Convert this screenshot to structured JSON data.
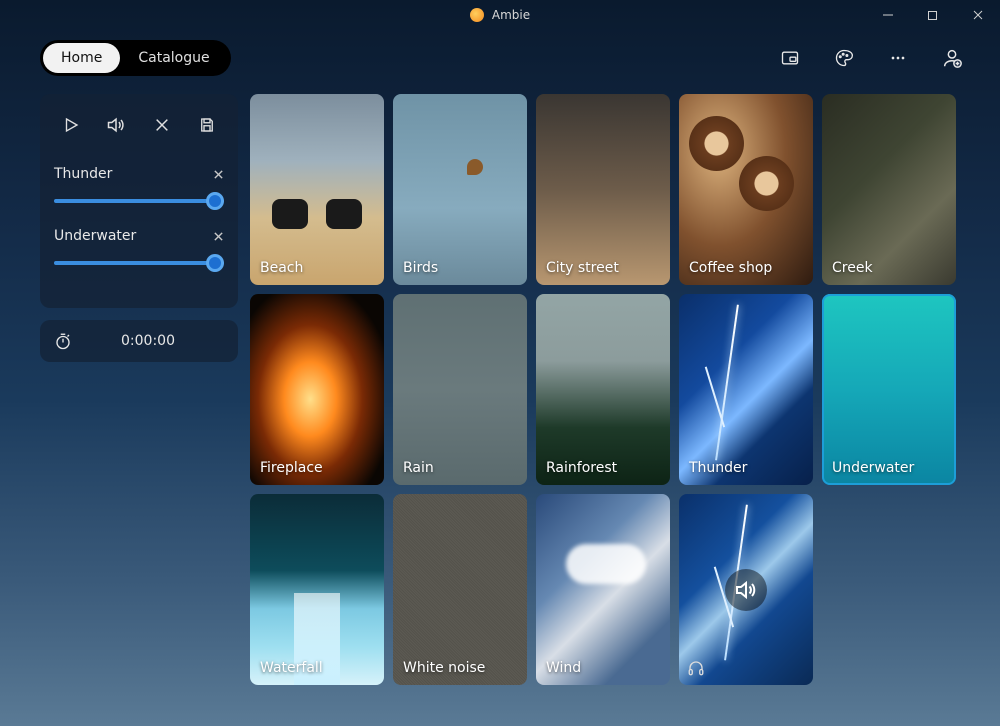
{
  "app": {
    "title": "Ambie"
  },
  "tabs": {
    "home": "Home",
    "catalogue": "Catalogue"
  },
  "panel": {
    "tracks": [
      {
        "name": "Thunder",
        "volume": 100
      },
      {
        "name": "Underwater",
        "volume": 100
      }
    ]
  },
  "timer": {
    "display": "0:00:00"
  },
  "sounds": [
    {
      "id": "beach",
      "label": "Beach"
    },
    {
      "id": "birds",
      "label": "Birds"
    },
    {
      "id": "city-street",
      "label": "City street"
    },
    {
      "id": "coffee-shop",
      "label": "Coffee shop"
    },
    {
      "id": "creek",
      "label": "Creek"
    },
    {
      "id": "fireplace",
      "label": "Fireplace"
    },
    {
      "id": "rain",
      "label": "Rain"
    },
    {
      "id": "rainforest",
      "label": "Rainforest"
    },
    {
      "id": "thunder",
      "label": "Thunder"
    },
    {
      "id": "underwater",
      "label": "Underwater",
      "selected": true
    },
    {
      "id": "waterfall",
      "label": "Waterfall"
    },
    {
      "id": "white-noise",
      "label": "White noise"
    },
    {
      "id": "wind",
      "label": "Wind"
    },
    {
      "id": "empty-slot",
      "label": "",
      "playing_badge": true,
      "headphones": true
    }
  ]
}
